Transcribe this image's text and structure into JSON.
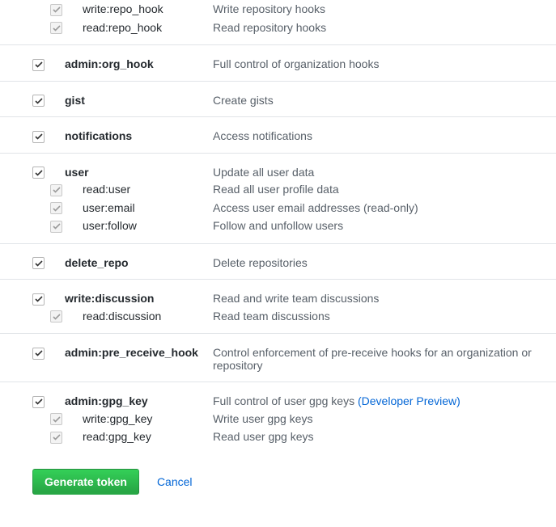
{
  "scopes": [
    {
      "first": true,
      "children_only": true,
      "children": [
        {
          "name": "write:repo_hook",
          "desc": "Write repository hooks",
          "checked": true,
          "disabled": true
        },
        {
          "name": "read:repo_hook",
          "desc": "Read repository hooks",
          "checked": true,
          "disabled": true
        }
      ]
    },
    {
      "name": "admin:org_hook",
      "desc": "Full control of organization hooks",
      "checked": true,
      "children": []
    },
    {
      "name": "gist",
      "desc": "Create gists",
      "checked": true,
      "children": []
    },
    {
      "name": "notifications",
      "desc": "Access notifications",
      "checked": true,
      "children": []
    },
    {
      "name": "user",
      "desc": "Update all user data",
      "checked": true,
      "children": [
        {
          "name": "read:user",
          "desc": "Read all user profile data",
          "checked": true,
          "disabled": true
        },
        {
          "name": "user:email",
          "desc": "Access user email addresses (read-only)",
          "checked": true,
          "disabled": true
        },
        {
          "name": "user:follow",
          "desc": "Follow and unfollow users",
          "checked": true,
          "disabled": true
        }
      ]
    },
    {
      "name": "delete_repo",
      "desc": "Delete repositories",
      "checked": true,
      "children": []
    },
    {
      "name": "write:discussion",
      "desc": "Read and write team discussions",
      "checked": true,
      "children": [
        {
          "name": "read:discussion",
          "desc": "Read team discussions",
          "checked": true,
          "disabled": true
        }
      ]
    },
    {
      "name": "admin:pre_receive_hook",
      "desc": "Control enforcement of pre-receive hooks for an organization or repository",
      "checked": true,
      "children": []
    },
    {
      "name": "admin:gpg_key",
      "desc_prefix": "Full control of user gpg keys ",
      "desc_link": "(Developer Preview)",
      "checked": true,
      "children": [
        {
          "name": "write:gpg_key",
          "desc": "Write user gpg keys",
          "checked": true,
          "disabled": true
        },
        {
          "name": "read:gpg_key",
          "desc": "Read user gpg keys",
          "checked": true,
          "disabled": true
        }
      ]
    }
  ],
  "actions": {
    "generate": "Generate token",
    "cancel": "Cancel"
  }
}
